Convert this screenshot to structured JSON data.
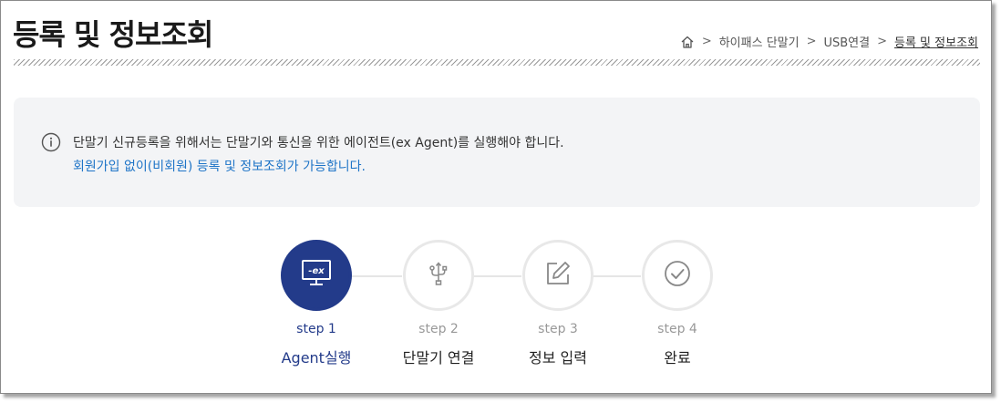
{
  "header": {
    "title": "등록 및 정보조회",
    "breadcrumb": [
      "하이패스 단말기",
      "USB연결",
      "등록 및 정보조회"
    ]
  },
  "notice": {
    "line1": "단말기 신규등록을 위해서는 단말기와 통신을 위한 에이전트(ex Agent)를 실행해야 합니다.",
    "line2": "회원가입 없이(비회원) 등록 및 정보조회가 가능합니다."
  },
  "steps": [
    {
      "num": "step 1",
      "name": "Agent실행",
      "icon": "ex-monitor-icon",
      "active": true
    },
    {
      "num": "step 2",
      "name": "단말기 연결",
      "icon": "usb-icon",
      "active": false
    },
    {
      "num": "step 3",
      "name": "정보 입력",
      "icon": "edit-icon",
      "active": false
    },
    {
      "num": "step 4",
      "name": "완료",
      "icon": "check-circle-icon",
      "active": false
    }
  ],
  "colors": {
    "accent": "#233b8a",
    "link": "#1e74c7",
    "panel": "#f3f4f6"
  }
}
